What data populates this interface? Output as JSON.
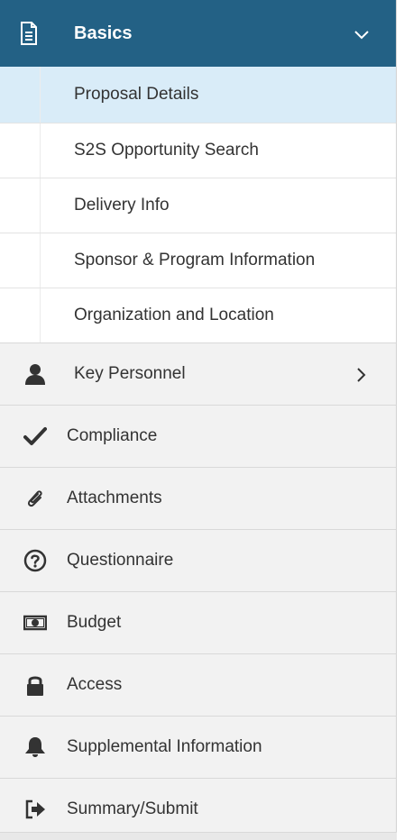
{
  "header": {
    "label": "Basics",
    "icon": "document-icon",
    "chevron": "chevron-down-icon",
    "bg": "#236185"
  },
  "subitems": [
    {
      "label": "Proposal Details",
      "active": true
    },
    {
      "label": "S2S Opportunity Search"
    },
    {
      "label": "Delivery Info"
    },
    {
      "label": "Sponsor & Program Information"
    },
    {
      "label": "Organization and Location"
    }
  ],
  "items": [
    {
      "label": "Key Personnel",
      "icon": "person-icon",
      "chevron": "chevron-right-icon"
    },
    {
      "label": "Compliance",
      "icon": "checkmark-icon"
    },
    {
      "label": "Attachments",
      "icon": "paperclip-icon"
    },
    {
      "label": "Questionnaire",
      "icon": "question-circle-icon"
    },
    {
      "label": "Budget",
      "icon": "money-icon"
    },
    {
      "label": "Access",
      "icon": "lock-icon"
    },
    {
      "label": "Supplemental Information",
      "icon": "bell-icon"
    },
    {
      "label": "Summary/Submit",
      "icon": "sign-out-icon"
    }
  ],
  "colors": {
    "active_sub": "#d9ecf8",
    "text": "#333333"
  }
}
